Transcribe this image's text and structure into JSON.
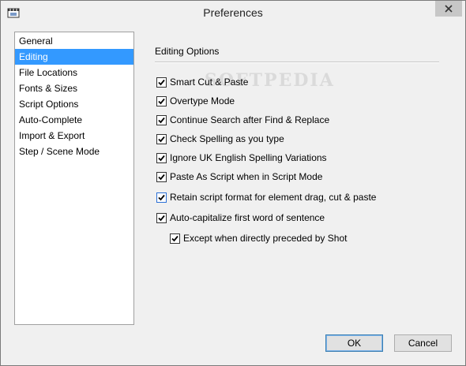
{
  "window": {
    "title": "Preferences"
  },
  "colors": {
    "selection": "#3399ff",
    "close_button": "#c7c7c7",
    "checkbox_accent": "#2a6fd6"
  },
  "icons": {
    "app": "film-clapper-icon",
    "close": "close-icon",
    "check": "checkmark-icon"
  },
  "nav": {
    "items": [
      {
        "label": "General",
        "selected": false
      },
      {
        "label": "Editing",
        "selected": true
      },
      {
        "label": "File Locations",
        "selected": false
      },
      {
        "label": "Fonts & Sizes",
        "selected": false
      },
      {
        "label": "Script Options",
        "selected": false
      },
      {
        "label": "Auto-Complete",
        "selected": false
      },
      {
        "label": "Import & Export",
        "selected": false
      },
      {
        "label": "Step / Scene Mode",
        "selected": false
      }
    ]
  },
  "panel": {
    "header": "Editing Options",
    "options": [
      {
        "label": "Smart Cut & Paste",
        "checked": true
      },
      {
        "label": "Overtype Mode",
        "checked": true
      },
      {
        "label": "Continue Search after Find & Replace",
        "checked": true
      },
      {
        "label": "Check Spelling as you type",
        "checked": true
      },
      {
        "label": "Ignore UK English Spelling Variations",
        "checked": true
      },
      {
        "label": "Paste As Script when in Script Mode",
        "checked": true
      },
      {
        "label": "Retain script format for element drag, cut & paste",
        "checked": true
      },
      {
        "label": "Auto-capitalize first word of sentence",
        "checked": true
      },
      {
        "label": "Except when directly preceded by Shot",
        "checked": true
      }
    ]
  },
  "watermark": "SOFTPEDIA",
  "buttons": {
    "ok": "OK",
    "cancel": "Cancel"
  }
}
